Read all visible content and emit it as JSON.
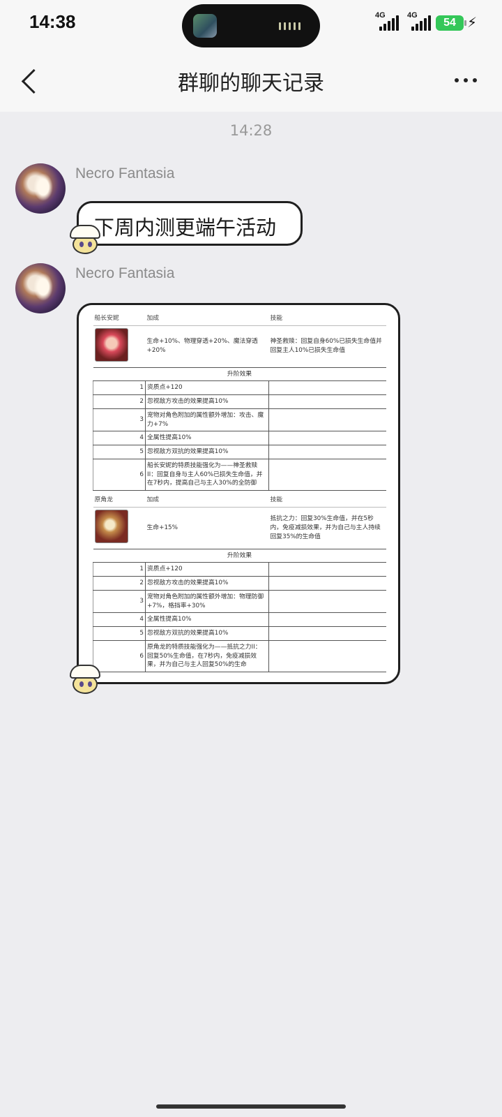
{
  "status": {
    "time": "14:38",
    "net1": "4G",
    "net2": "4G",
    "battery": "54"
  },
  "nav": {
    "title": "群聊的聊天记录"
  },
  "chat": {
    "timestamp": "14:28",
    "messages": [
      {
        "sender": "Necro Fantasia",
        "text": "下周内测更端午活动"
      },
      {
        "sender": "Necro Fantasia"
      }
    ]
  },
  "sheet": {
    "pets": [
      {
        "col_name": "船长安妮",
        "col_bonus": "加成",
        "col_skill": "技能",
        "bonus": "生命+10%、物理穿透+20%、魔法穿透+20%",
        "skill": "神圣救赎：回复自身60%已损失生命值并回复主人10%已损失生命值",
        "section": "升阶效果",
        "rows": [
          {
            "n": "1",
            "t": "资质点+120"
          },
          {
            "n": "2",
            "t": "忽视敌方攻击的效果提高10%"
          },
          {
            "n": "3",
            "t": "宠物对角色附加的属性额外增加：攻击、魔力+7%"
          },
          {
            "n": "4",
            "t": "全属性提高10%"
          },
          {
            "n": "5",
            "t": "忽视敌方双抗的效果提高10%"
          },
          {
            "n": "6",
            "t": "船长安妮的特质技能强化为——神圣救赎II：回复自身与主人60%已损失生命值，并在7秒内，提高自己与主人30%的全防御"
          }
        ]
      },
      {
        "col_name": "原角龙",
        "col_bonus": "加成",
        "col_skill": "技能",
        "bonus": "生命+15%",
        "skill": "抵抗之力：回复30%生命值，并在5秒内，免疫减损效果，并为自己与主人持续回复35%的生命值",
        "section": "升阶效果",
        "rows": [
          {
            "n": "1",
            "t": "资质点+120"
          },
          {
            "n": "2",
            "t": "忽视敌方攻击的效果提高10%"
          },
          {
            "n": "3",
            "t": "宠物对角色附加的属性额外增加：物理防御+7%，格挡率+30%"
          },
          {
            "n": "4",
            "t": "全属性提高10%"
          },
          {
            "n": "5",
            "t": "忽视敌方双抗的效果提高10%"
          },
          {
            "n": "6",
            "t": "原角龙的特质技能强化为——抵抗之力II：回复50%生命值，在7秒内，免疫减损效果，并为自己与主人回复50%的生命"
          }
        ]
      }
    ]
  }
}
